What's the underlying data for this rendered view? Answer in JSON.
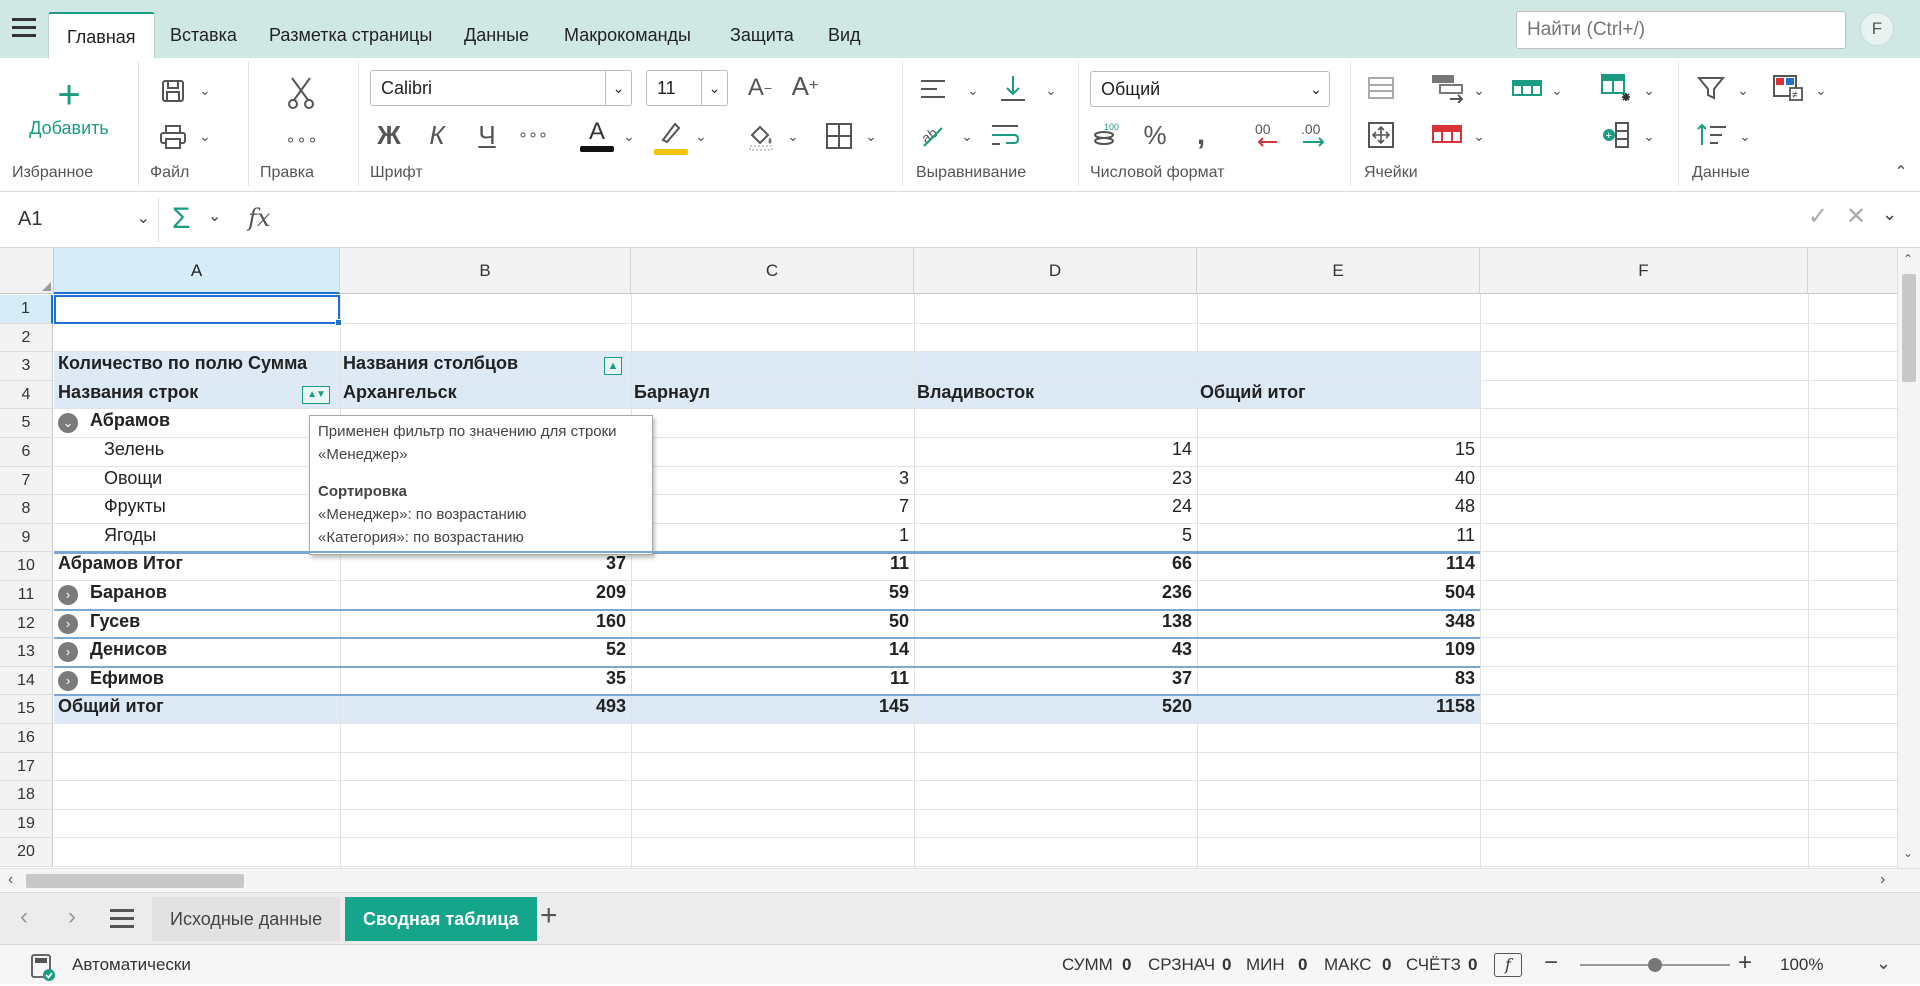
{
  "menu": {
    "hamburger": "≡",
    "tabs": [
      "Главная",
      "Вставка",
      "Разметка страницы",
      "Данные",
      "Макрокоманды",
      "Защита",
      "Вид"
    ],
    "active": "Главная",
    "search_placeholder": "Найти (Ctrl+/)",
    "user_initial": "F"
  },
  "ribbon": {
    "add_label": "Добавить",
    "groups": [
      "Избранное",
      "Файл",
      "Правка",
      "Шрифт",
      "Выравнивание",
      "Числовой формат",
      "Ячейки",
      "Данные"
    ],
    "font_name": "Calibri",
    "font_size": "11",
    "number_format": "Общий",
    "bold": "Ж",
    "italic": "К",
    "underline": "Ч",
    "more": "∘∘∘",
    "grow": "A",
    "shrink": "A",
    "colors": {
      "font": "#111111",
      "highlight": "#f2c300",
      "accent": "#1a9b83"
    }
  },
  "formula_bar": {
    "cell_ref": "A1",
    "sum_symbol": "Σ",
    "fx": "fx",
    "value": ""
  },
  "grid": {
    "columns": [
      "A",
      "B",
      "C",
      "D",
      "E",
      "F"
    ],
    "rows": [
      "1",
      "2",
      "3",
      "4",
      "5",
      "6",
      "7",
      "8",
      "9",
      "10",
      "11",
      "12",
      "13",
      "14",
      "15",
      "16",
      "17",
      "18",
      "19",
      "20"
    ],
    "pivot": {
      "header_value_label": "Количество по полю Сумма",
      "col_labels_caption": "Названия столбцов",
      "row_labels_caption": "Названия строк",
      "col_headers": [
        "Архангельск",
        "Барнаул",
        "Владивосток",
        "Общий итог"
      ],
      "group_expanded": {
        "name": "Абрамов"
      },
      "children": [
        {
          "name": "Зелень",
          "vals": [
            "",
            "",
            "14",
            "15"
          ]
        },
        {
          "name": "Овощи",
          "vals": [
            "",
            "3",
            "23",
            "40"
          ]
        },
        {
          "name": "Фрукты",
          "vals": [
            "",
            "7",
            "24",
            "48"
          ]
        },
        {
          "name": "Ягоды",
          "vals": [
            "",
            "1",
            "5",
            "11"
          ]
        }
      ],
      "subtotal": {
        "name": "Абрамов Итог",
        "vals": [
          "37",
          "11",
          "66",
          "114"
        ]
      },
      "collapsed": [
        {
          "name": "Баранов",
          "vals": [
            "209",
            "59",
            "236",
            "504"
          ]
        },
        {
          "name": "Гусев",
          "vals": [
            "160",
            "50",
            "138",
            "348"
          ]
        },
        {
          "name": "Денисов",
          "vals": [
            "52",
            "14",
            "43",
            "109"
          ]
        },
        {
          "name": "Ефимов",
          "vals": [
            "35",
            "11",
            "37",
            "83"
          ]
        }
      ],
      "grand_total": {
        "name": "Общий итог",
        "vals": [
          "493",
          "145",
          "520",
          "1158"
        ]
      }
    },
    "tooltip": {
      "line1": "Применен фильтр по значению для строки",
      "line2": "«Менеджер»",
      "sort_title": "Сортировка",
      "sort1": "«Менеджер»: по возрастанию",
      "sort2": "«Категория»: по возрастанию"
    }
  },
  "sheets": {
    "tabs": [
      "Исходные данные",
      "Сводная таблица"
    ],
    "active": "Сводная таблица"
  },
  "status": {
    "calc_mode": "Автоматически",
    "sum_label": "СУММ",
    "sum": "0",
    "avg_label": "СРЗНАЧ",
    "avg": "0",
    "min_label": "МИН",
    "min": "0",
    "max_label": "МАКС",
    "max": "0",
    "count_label": "СЧЁТЗ",
    "count": "0",
    "zoom": "100%",
    "zoom_level": 0.5
  }
}
